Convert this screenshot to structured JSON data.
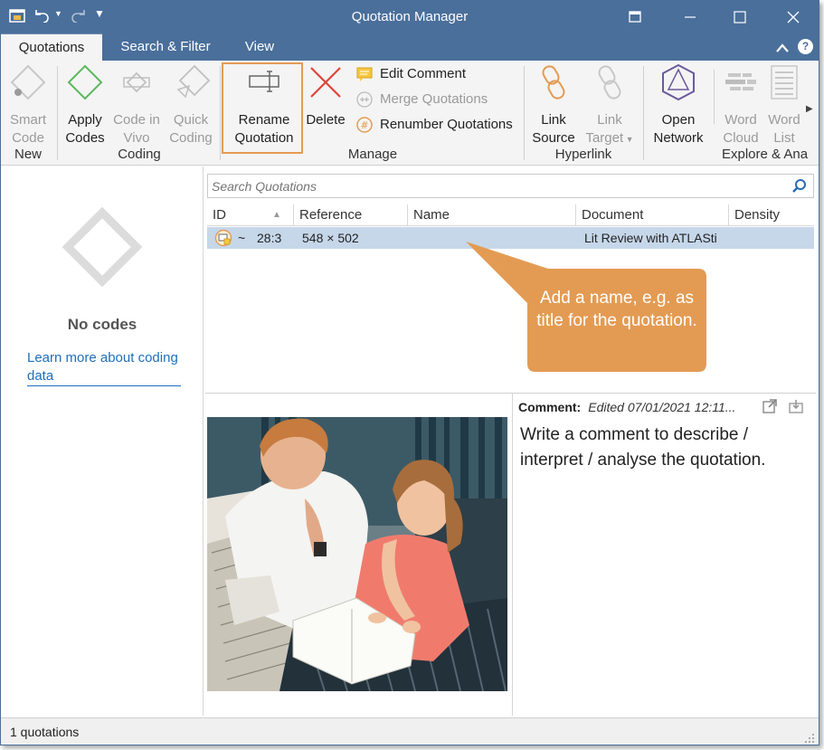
{
  "window": {
    "title": "Quotation Manager"
  },
  "tabs": [
    {
      "label": "Quotations",
      "active": true
    },
    {
      "label": "Search & Filter",
      "active": false
    },
    {
      "label": "View",
      "active": false
    }
  ],
  "ribbon": {
    "groups": {
      "new": "New",
      "coding": "Coding",
      "manage": "Manage",
      "hyperlink": "Hyperlink",
      "explore": "Explore & Ana"
    },
    "smart_code": [
      "Smart",
      "Code"
    ],
    "apply_codes": [
      "Apply",
      "Codes"
    ],
    "code_in_vivo": [
      "Code in",
      "Vivo"
    ],
    "quick_coding": [
      "Quick",
      "Coding"
    ],
    "rename_quotation": [
      "Rename",
      "Quotation"
    ],
    "delete": "Delete",
    "edit_comment": "Edit Comment",
    "merge_quotations": "Merge Quotations",
    "renumber_quotations": "Renumber Quotations",
    "link_source": [
      "Link",
      "Source"
    ],
    "link_target": [
      "Link",
      "Target"
    ],
    "open_network": [
      "Open",
      "Network"
    ],
    "word_cloud": [
      "Word",
      "Cloud"
    ],
    "word_list": [
      "Word",
      "List"
    ]
  },
  "left_panel": {
    "empty_title": "No codes",
    "learn_more": "Learn more about coding data"
  },
  "search": {
    "placeholder": "Search Quotations"
  },
  "table": {
    "columns": [
      "ID",
      "Reference",
      "Name",
      "Document",
      "Density"
    ],
    "rows": [
      {
        "id": "28:3",
        "prefix": "~",
        "reference": "548 × 502",
        "name": "",
        "document": "Lit Review with ATLASti",
        "density": ""
      }
    ]
  },
  "callout": {
    "text": "Add a name, e.g. as title for the quotation.",
    "color": "#e39b53"
  },
  "comment": {
    "label": "Comment:",
    "meta": "Edited 07/01/2021 12:11...",
    "body": "Write a comment to describe / interpret / analyse the quotation."
  },
  "status": {
    "text": "1 quotations"
  },
  "colors": {
    "titlebar": "#4a6f9b",
    "selection": "#c6d7ea",
    "accent_green": "#5cb85c",
    "accent_red": "#e0443a",
    "accent_orange": "#e39b53"
  }
}
